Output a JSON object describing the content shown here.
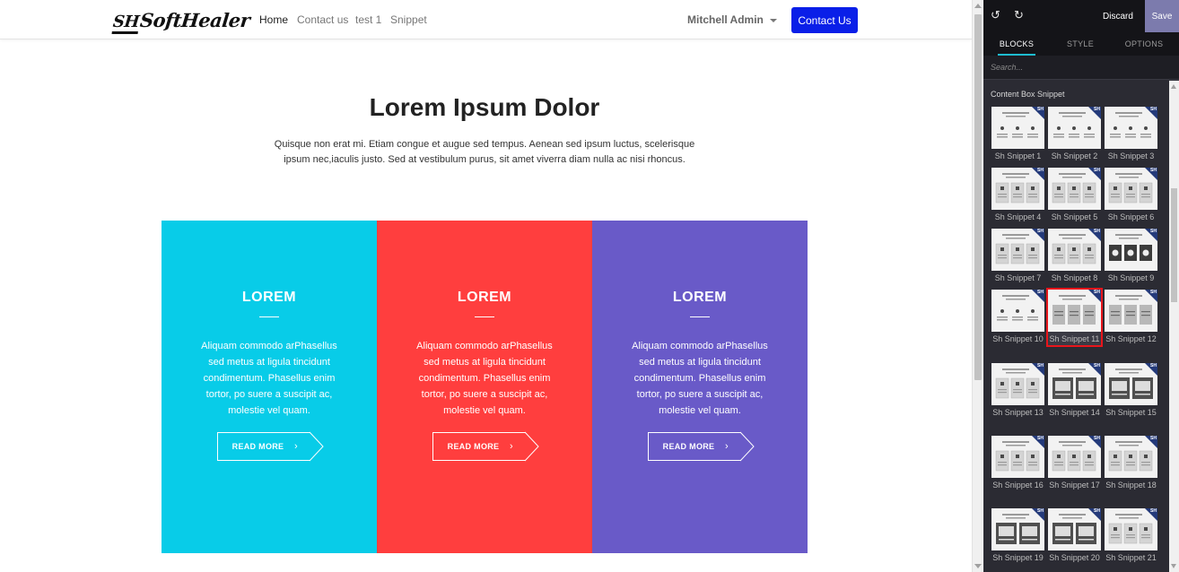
{
  "navbar": {
    "logo_mark": "SH",
    "logo_text": "SoftHealer",
    "links": [
      {
        "label": "Home"
      },
      {
        "label": "Contact us"
      },
      {
        "label": "test 1"
      },
      {
        "label": "Snippet"
      }
    ],
    "user": "Mitchell Admin",
    "contact_button": "Contact Us"
  },
  "hero": {
    "title": "Lorem Ipsum Dolor",
    "text": "Quisque non erat mi. Etiam congue et augue sed tempus. Aenean sed ipsum luctus, scelerisque ipsum nec,iaculis justo. Sed at vestibulum purus, sit amet viverra diam nulla ac nisi rhoncus."
  },
  "boxes": [
    {
      "title": "LOREM",
      "text": "Aliquam commodo arPhasellus sed metus at ligula tincidunt condimentum. Phasellus enim tortor, po suere a suscipit ac, molestie vel quam.",
      "button": "READ MORE",
      "color": "#08cce8"
    },
    {
      "title": "LOREM",
      "text": "Aliquam commodo arPhasellus sed metus at ligula tincidunt condimentum. Phasellus enim tortor, po suere a suscipit ac, molestie vel quam.",
      "button": "READ MORE",
      "color": "#ff3e3e"
    },
    {
      "title": "LOREM",
      "text": "Aliquam commodo arPhasellus sed metus at ligula tincidunt condimentum. Phasellus enim tortor, po suere a suscipit ac, molestie vel quam.",
      "button": "READ MORE",
      "color": "#695ac8"
    }
  ],
  "editor": {
    "undo_icon": "undo-icon",
    "redo_icon": "redo-icon",
    "discard": "Discard",
    "save": "Save",
    "tabs": [
      {
        "label": "BLOCKS",
        "active": true
      },
      {
        "label": "STYLE",
        "active": false
      },
      {
        "label": "OPTIONS",
        "active": false
      }
    ],
    "search_placeholder": "Search...",
    "section_title": "Content Box Snippet",
    "snippets": [
      {
        "label": "Sh Snippet 1"
      },
      {
        "label": "Sh Snippet 2"
      },
      {
        "label": "Sh Snippet 3"
      },
      {
        "label": "Sh Snippet 4"
      },
      {
        "label": "Sh Snippet 5"
      },
      {
        "label": "Sh Snippet 6"
      },
      {
        "label": "Sh Snippet 7"
      },
      {
        "label": "Sh Snippet 8"
      },
      {
        "label": "Sh Snippet 9"
      },
      {
        "label": "Sh Snippet 10"
      },
      {
        "label": "Sh Snippet 11",
        "selected": true
      },
      {
        "label": "Sh Snippet 12"
      },
      {
        "label": "Sh Snippet 13"
      },
      {
        "label": "Sh Snippet 14"
      },
      {
        "label": "Sh Snippet 15"
      },
      {
        "label": "Sh Snippet 16"
      },
      {
        "label": "Sh Snippet 17"
      },
      {
        "label": "Sh Snippet 18"
      },
      {
        "label": "Sh Snippet 19"
      },
      {
        "label": "Sh Snippet 20"
      },
      {
        "label": "Sh Snippet 21"
      }
    ],
    "badge": "SH"
  }
}
